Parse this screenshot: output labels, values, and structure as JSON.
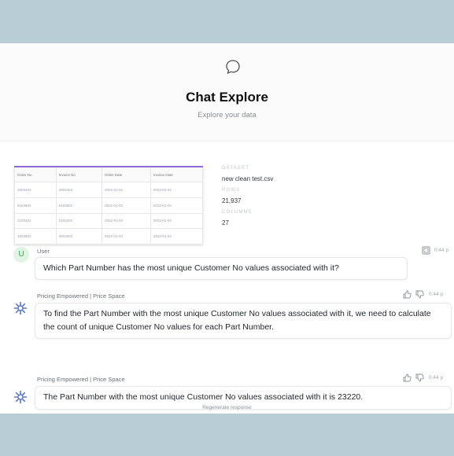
{
  "header": {
    "title": "Chat Explore",
    "subtitle": "Explore your data"
  },
  "dataset_preview": {
    "columns": [
      "Order No",
      "Invoice No",
      "Order Date",
      "Invoice Date"
    ],
    "rows": [
      [
        "2903403",
        "2903403",
        "2022-01-02",
        "2022-01-04"
      ],
      [
        "9153802",
        "9153802",
        "2022-01-03",
        "2022-01-04"
      ],
      [
        "2103402",
        "2103402",
        "2022-01-03",
        "2022-01-04"
      ],
      [
        "4903802",
        "4903802",
        "2022-01-03",
        "2022-01-04"
      ]
    ]
  },
  "dataset_meta": {
    "dataset_label": "DATASET",
    "dataset_value": "new clean test.csv",
    "rows_label": "ROWS",
    "rows_value": "21,937",
    "columns_label": "COLUMNS",
    "columns_value": "27"
  },
  "messages": [
    {
      "sender": "User",
      "avatar": "U",
      "time": "0:44 p",
      "text": "Which Part Number has the most unique Customer No values associated with it?"
    },
    {
      "sender": "Pricing Empowered | Price Space",
      "time": "0:44 p",
      "text": "To find the Part Number with the most unique Customer No values associated with it, we need to calculate the count of unique Customer No values for each Part Number."
    },
    {
      "sender": "Pricing Empowered | Price Space",
      "time": "0:44 p",
      "text": "The Part Number with the most unique Customer No values associated with it is 23220."
    }
  ],
  "regenerate_label": "Regenerate response",
  "colors": {
    "accent": "#8e6bd6",
    "bot_icon": "#5b78c7",
    "user_avatar_bg": "#dff4e3",
    "background_band": "#b8cdd5"
  },
  "icons": [
    "chat-bubble-icon",
    "copy-icon",
    "thumbs-up-icon",
    "thumbs-down-icon",
    "bot-gear-icon"
  ]
}
